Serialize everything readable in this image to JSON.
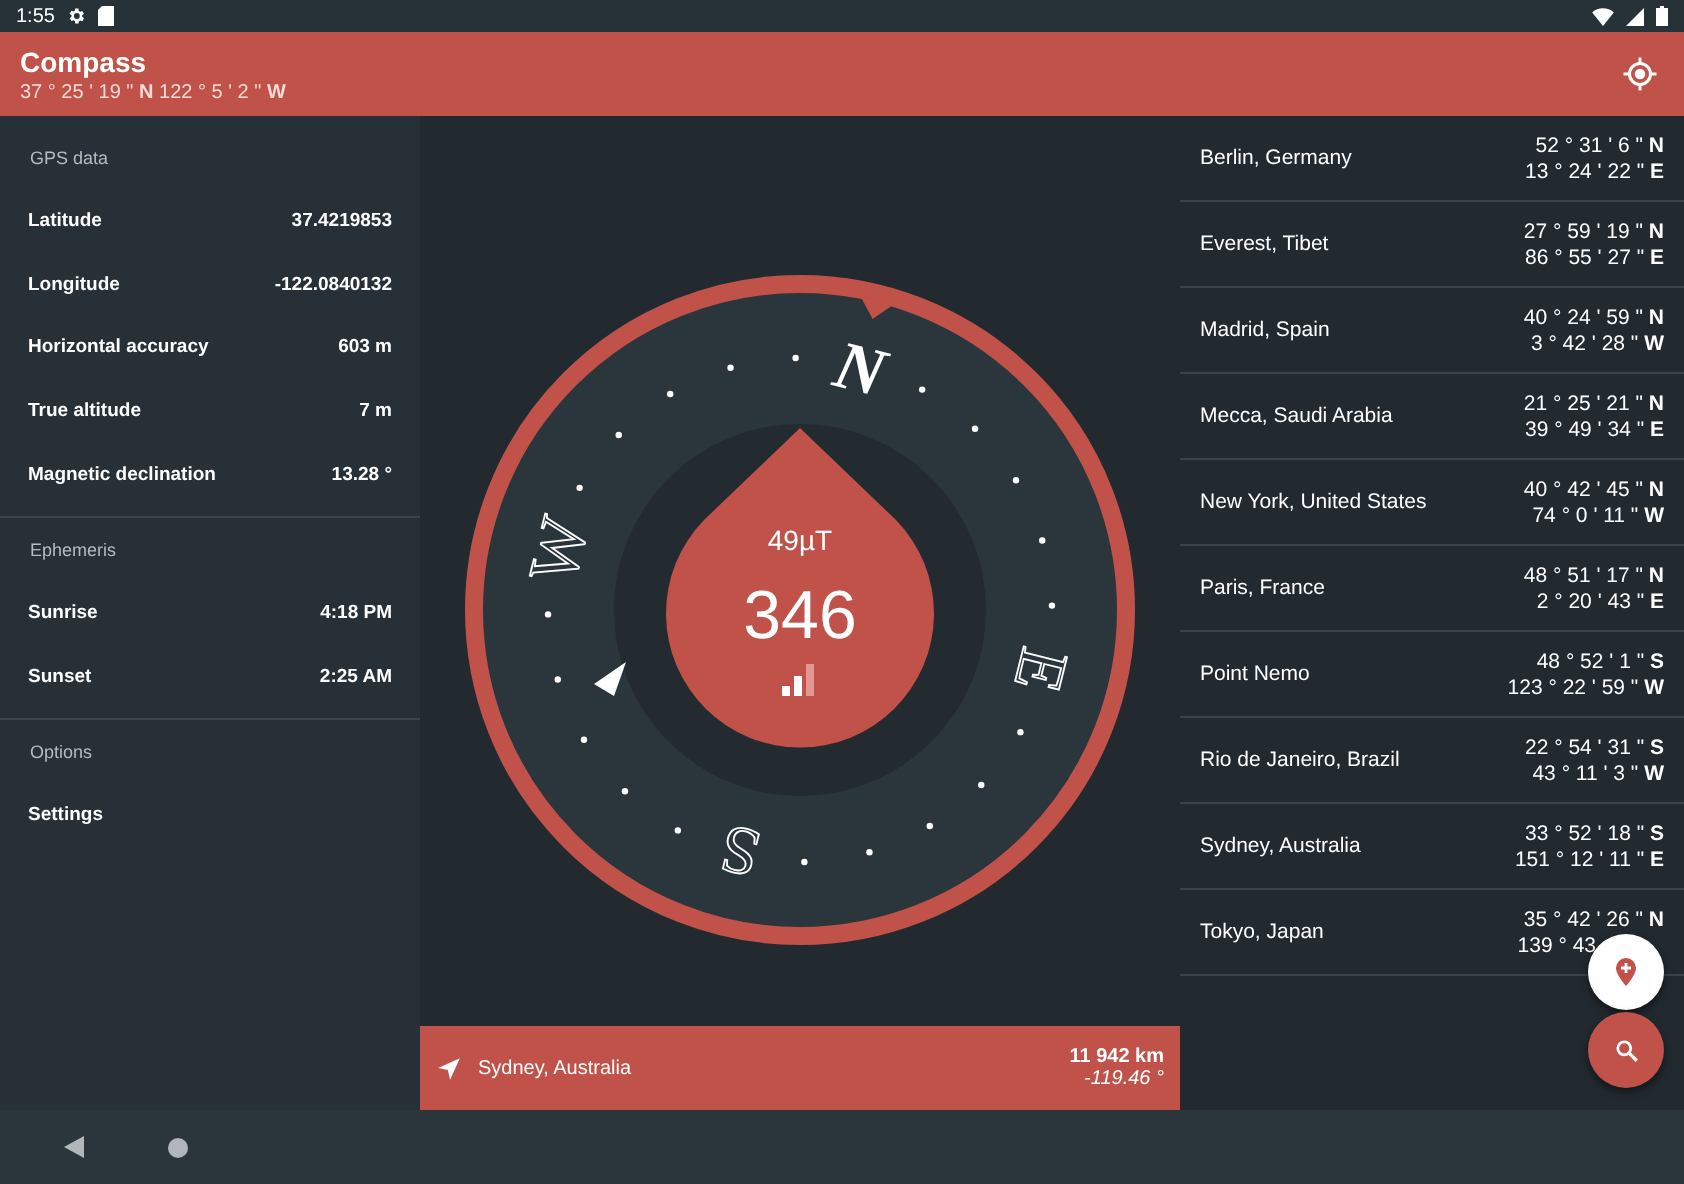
{
  "status_bar": {
    "time": "1:55"
  },
  "app_bar": {
    "title": "Compass",
    "subtitle": "37 ° 25 ' 19 \" **N** 122 ° 5 ' 2 \" **W**"
  },
  "sections": [
    {
      "title": "GPS data",
      "rows": [
        {
          "label": "Latitude",
          "value": "37.4219853"
        },
        {
          "label": "Longitude",
          "value": "-122.0840132"
        },
        {
          "label": "Horizontal accuracy",
          "value": "603 m"
        },
        {
          "label": "True altitude",
          "value": "7 m"
        },
        {
          "label": "Magnetic declination",
          "value": "13.28 °"
        }
      ]
    },
    {
      "title": "Ephemeris",
      "rows": [
        {
          "label": "Sunrise",
          "value": "4:18 PM"
        },
        {
          "label": "Sunset",
          "value": "2:25 AM"
        }
      ]
    },
    {
      "title": "Options",
      "rows": [
        {
          "label": "Settings"
        }
      ]
    }
  ],
  "compass": {
    "field": "49µT",
    "heading": "346",
    "cardinals": [
      "N",
      "E",
      "S",
      "W"
    ]
  },
  "places": [
    {
      "name": "Berlin, Germany",
      "lat": "52 ° 31 ' 6 \" **N**",
      "lon": "13 ° 24 ' 22 \" **E**"
    },
    {
      "name": "Everest, Tibet",
      "lat": "27 ° 59 ' 19 \" **N**",
      "lon": "86 ° 55 ' 27 \" **E**"
    },
    {
      "name": "Madrid, Spain",
      "lat": "40 ° 24 ' 59 \" **N**",
      "lon": "3 ° 42 ' 28 \" **W**"
    },
    {
      "name": "Mecca, Saudi Arabia",
      "lat": "21 ° 25 ' 21 \" **N**",
      "lon": "39 ° 49 ' 34 \" **E**"
    },
    {
      "name": "New York, United States",
      "lat": "40 ° 42 ' 45 \" **N**",
      "lon": "74 ° 0 ' 11 \" **W**"
    },
    {
      "name": "Paris, France",
      "lat": "48 ° 51 ' 17 \" **N**",
      "lon": "2 ° 20 ' 43 \" **E**"
    },
    {
      "name": "Point Nemo",
      "lat": "48 ° 52 ' 1 \" **S**",
      "lon": "123 ° 22 ' 59 \" **W**"
    },
    {
      "name": "Rio de Janeiro, Brazil",
      "lat": "22 ° 54 ' 31 \" **S**",
      "lon": "43 ° 11 ' 3 \" **W**"
    },
    {
      "name": "Sydney, Australia",
      "lat": "33 ° 52 ' 18 \" **S**",
      "lon": "151 ° 12 ' 11 \" **E**"
    },
    {
      "name": "Tokyo, Japan",
      "lat": "35 ° 42 ' 26 \" **N**",
      "lon": "139 ° 43"
    }
  ],
  "destination": {
    "name": "Sydney, Australia",
    "distance": "11 942 km",
    "bearing": "-119.46 °"
  }
}
